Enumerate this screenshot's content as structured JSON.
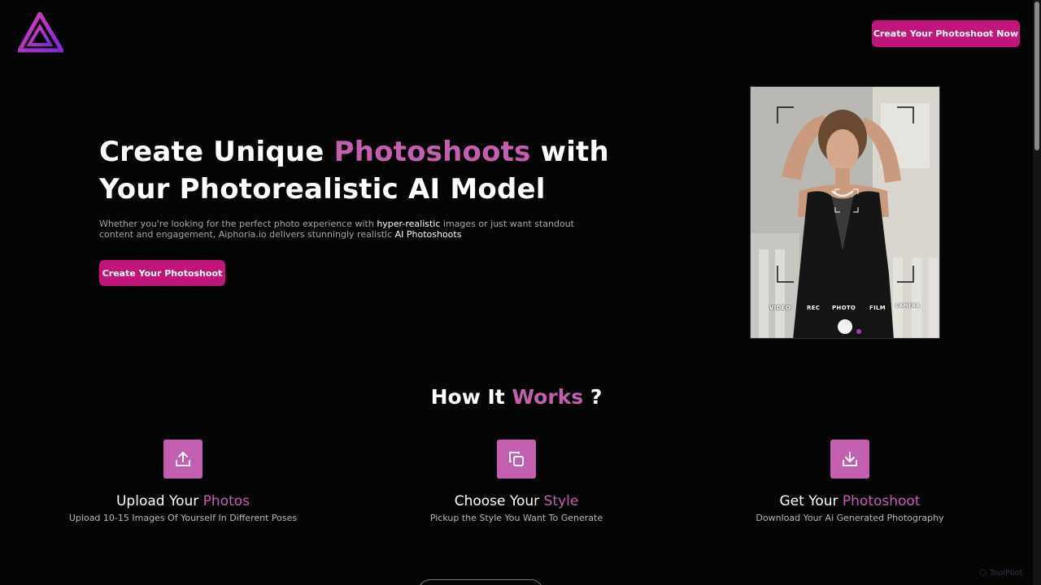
{
  "header": {
    "cta_label": "Create Your Photoshoot Now"
  },
  "hero": {
    "title_part1": "Create  Unique ",
    "title_accent": "Photoshoots",
    "title_part2": "  with",
    "title_line2": "Your Photorealistic AI Model",
    "desc_part1": "Whether you're looking for the perfect photo experience with ",
    "desc_hl1": "hyper-realistic",
    "desc_part2": " images or just want standout content and engagement, Aiphoria.io delivers stunningly realistic ",
    "desc_hl2": "AI Photoshoots",
    "cta_label": "Create Your Photoshoot"
  },
  "photo": {
    "modes": [
      "VIDEO",
      "REC",
      "PHOTO",
      "FILM",
      "CAMERA"
    ]
  },
  "how": {
    "title_part1": "How It ",
    "title_accent": "Works",
    "title_part2": " ?",
    "steps": [
      {
        "icon": "upload-icon",
        "title": "Upload Your ",
        "accent": "Photos",
        "desc": "Upload 10-15 Images Of Yourself In Different Poses"
      },
      {
        "icon": "copy-icon",
        "title": "Choose Your ",
        "accent": "Style",
        "desc": "Pickup the Style You Want To Generate"
      },
      {
        "icon": "download-icon",
        "title": "Get Your ",
        "accent": "Photoshoot",
        "desc": "Download Your Ai Generated Photography"
      }
    ]
  },
  "watermark": "ToolPilot",
  "colors": {
    "brand": "#c2157a",
    "accent": "#c45fae",
    "background": "#050505"
  }
}
